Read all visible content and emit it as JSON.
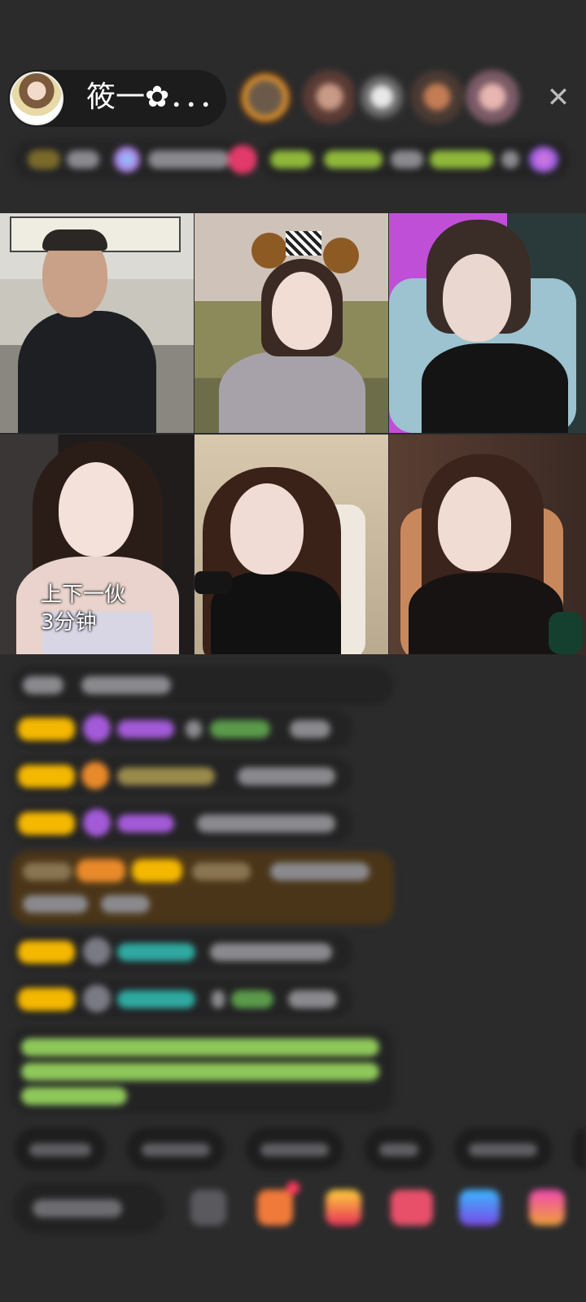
{
  "header": {
    "host_name": "筱一✿．．．",
    "close_icon": "close-icon"
  },
  "grid": {
    "tile_1_caption_line1": "上下一伙",
    "tile_1_caption_line2": "3分钟"
  },
  "colors": {
    "background": "#2b2b2c",
    "badge_yellow": "#f5b800",
    "gift_orange": "#e98a2a",
    "highlight_row": "#4a3518",
    "system_green": "#8fc85a",
    "name_teal": "#2fa9a0",
    "name_purple": "#a35ad8"
  }
}
